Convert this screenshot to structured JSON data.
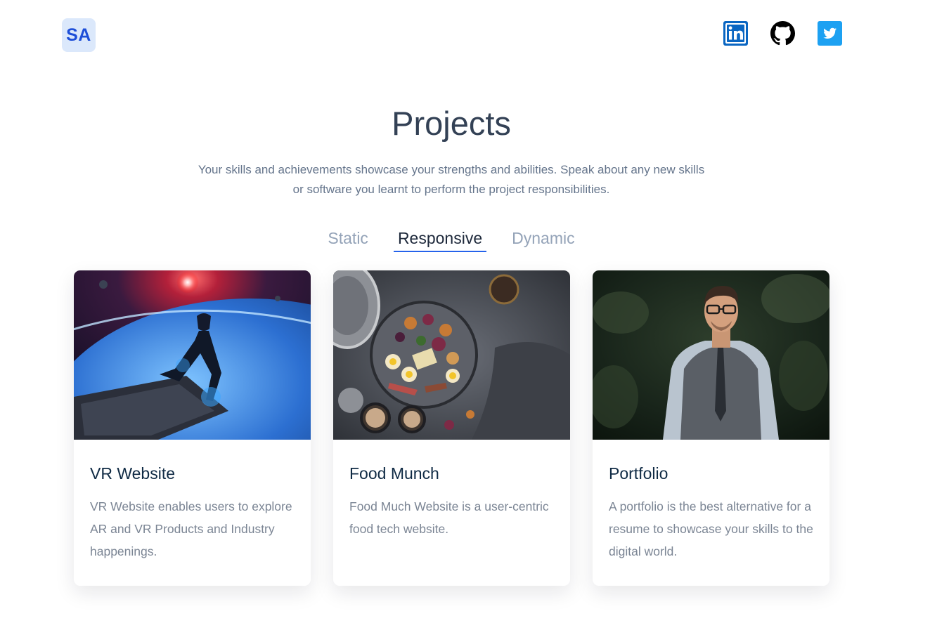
{
  "logo": {
    "text": "SA"
  },
  "socials": [
    {
      "icon": "linkedin-icon",
      "color": "#0a66c2"
    },
    {
      "icon": "github-icon",
      "color": "#000000"
    },
    {
      "icon": "twitter-icon",
      "color": "#1da1f2"
    }
  ],
  "section": {
    "title": "Projects",
    "description": "Your skills and achievements showcase your strengths and abilities. Speak about any new skills or software you learnt to perform the project responsibilities."
  },
  "tabs": [
    {
      "label": "Static",
      "active": false
    },
    {
      "label": "Responsive",
      "active": true
    },
    {
      "label": "Dynamic",
      "active": false
    }
  ],
  "accent_color": "#2563eb",
  "projects": [
    {
      "title": "VR Website",
      "description": "VR Website enables users to explore AR and VR Products and Industry happenings.",
      "image": "vr-space-image"
    },
    {
      "title": "Food Munch",
      "description": "Food Much Website is a user-centric food tech website.",
      "image": "food-platter-image"
    },
    {
      "title": "Portfolio",
      "description": "A portfolio is the best alternative for a resume to showcase your skills to the digital world.",
      "image": "portrait-man-image"
    }
  ]
}
